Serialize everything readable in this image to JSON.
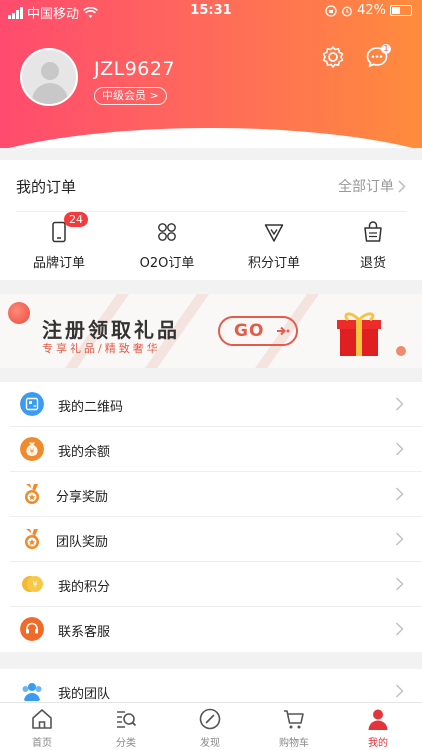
{
  "status_bar": {
    "carrier": "中国移动",
    "time": "15:31",
    "battery": "42%"
  },
  "profile": {
    "username": "JZL9627",
    "member_level": "中级会员 >",
    "message_count": "1"
  },
  "orders": {
    "title": "我的订单",
    "all_label": "全部订单",
    "items": [
      {
        "label": "品牌订单",
        "badge": "24",
        "icon": "phone-order-icon"
      },
      {
        "label": "O2O订单",
        "icon": "four-circles-icon"
      },
      {
        "label": "积分订单",
        "icon": "diamond-icon"
      },
      {
        "label": "退货",
        "icon": "return-bag-icon"
      }
    ]
  },
  "banner": {
    "title": "注册领取礼品",
    "subtitle": "专享礼品/精致奢华",
    "button": "GO",
    "icon": "gift-box-icon"
  },
  "menu": [
    {
      "label": "我的二维码",
      "icon": "qrcode-icon",
      "color": "#3a9bf0"
    },
    {
      "label": "我的余额",
      "icon": "money-bag-icon",
      "color": "#f08a2a"
    },
    {
      "label": "分享奖励",
      "icon": "medal-icon",
      "color": "#f08a2a"
    },
    {
      "label": "团队奖励",
      "icon": "medal-icon",
      "color": "#f08a2a"
    },
    {
      "label": "我的积分",
      "icon": "coins-icon",
      "color": "#f5b82e"
    },
    {
      "label": "联系客服",
      "icon": "headset-icon",
      "color": "#f06a2a"
    }
  ],
  "menu2": {
    "label": "我的团队",
    "icon": "team-icon",
    "color": "#3a9bf0"
  },
  "tabbar": [
    {
      "label": "首页",
      "icon": "home-icon"
    },
    {
      "label": "分类",
      "icon": "category-search-icon"
    },
    {
      "label": "发现",
      "icon": "compass-icon"
    },
    {
      "label": "购物车",
      "icon": "cart-icon"
    },
    {
      "label": "我的",
      "icon": "user-icon",
      "active": true
    }
  ],
  "colors": {
    "header_start": "#ff4b6e",
    "header_end": "#ff8c3c",
    "accent": "#e2343a",
    "badge": "#f43a3a"
  }
}
